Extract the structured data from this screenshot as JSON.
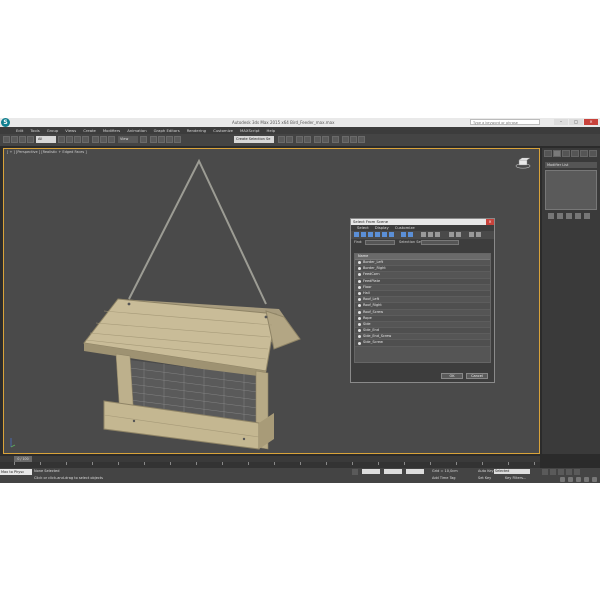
{
  "title_bar": {
    "app_logo": "3ds-max-logo",
    "title": "Autodesk 3ds Max 2015 x64     Bird_Feeder_max.max",
    "search_placeholder": "Type a keyword or phrase",
    "minimize": "–",
    "maximize": "□",
    "close": "×"
  },
  "menubar": {
    "items": [
      "Edit",
      "Tools",
      "Group",
      "Views",
      "Create",
      "Modifiers",
      "Animation",
      "Graph Editors",
      "Rendering",
      "Customize",
      "MAXScript",
      "Help"
    ]
  },
  "toolbar": {
    "filter_value": "All",
    "view_value": "View",
    "selection_set_value": "Create Selection Se"
  },
  "viewport": {
    "label": "[ + ] [Perspective ] [Realistic + Edged Faces ]"
  },
  "command_panel": {
    "modifier_list_label": "Modifier List"
  },
  "select_dialog": {
    "title": "Select From Scene",
    "close": "×",
    "menu": [
      "Select",
      "Display",
      "Customize"
    ],
    "find_label": "Find:",
    "selection_set_label": "Selection Set:",
    "ok_label": "OK",
    "cancel_label": "Cancel",
    "list_header": "Name",
    "items": [
      "Border_Left",
      "Border_Right",
      "FeedCorn",
      "FeedPlate",
      "Floor",
      "Hall",
      "Roof_Left",
      "Roof_Right",
      "Roof_Screw",
      "Rope",
      "Side",
      "Side_End",
      "Side_End_Screw",
      "Side_Screw"
    ]
  },
  "timeline": {
    "frame_readout": "0 / 100"
  },
  "status": {
    "script_label": "Max to Physc",
    "selection_text": "None Selected",
    "prompt_text": "Click or click-and-drag to select objects",
    "grid_label": "Grid = 10,0cm",
    "auto_key_label": "Auto Key",
    "auto_key_value": "Selected",
    "set_key_label": "Set Key",
    "key_filters_label": "Key Filters...",
    "add_time_tag_label": "Add Time Tag"
  }
}
